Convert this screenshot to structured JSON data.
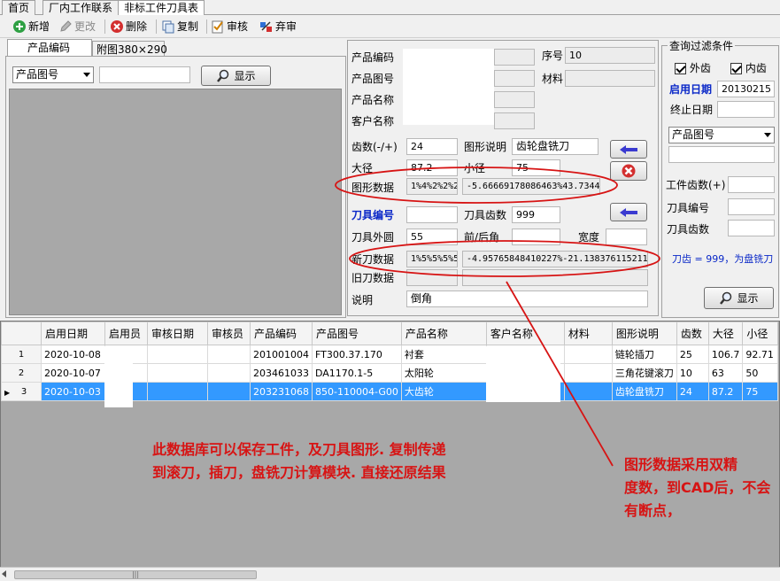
{
  "tabs": [
    {
      "label": "首页"
    },
    {
      "label": "厂内工作联系"
    },
    {
      "label": "非标工件刀具表"
    }
  ],
  "toolbar": {
    "new": "新增",
    "edit": "更改",
    "delete": "删除",
    "copy": "复制",
    "approve": "审核",
    "unapprove": "弃审"
  },
  "left_tabs": {
    "code": "产品编码",
    "image": "附图380×290"
  },
  "left": {
    "dropdown": "产品图号",
    "search_value": "",
    "show_button": "显示"
  },
  "form": {
    "product_code_label": "产品编码",
    "product_code": "",
    "seq_label": "序号",
    "seq": "10",
    "drawing_no_label": "产品图号",
    "drawing_no": "",
    "material_label": "材料",
    "material": "",
    "product_name_label": "产品名称",
    "product_name": "",
    "customer_label": "客户名称",
    "customer": "",
    "teeth_label": "齿数(-/+)",
    "teeth": "24",
    "shape_desc_label": "图形说明",
    "shape_desc": "齿轮盘铣刀",
    "major_label": "大径",
    "major": "87.2",
    "minor_label": "小径",
    "minor": "75",
    "shape_data_label": "图形数据",
    "shape_data_a": "1%4%2%2%2",
    "shape_data_b": "-5.66669178086463%43.7344",
    "tool_no_label": "刀具编号",
    "tool_no": "",
    "tool_teeth_label": "刀具齿数",
    "tool_teeth": "999",
    "tool_od_label": "刀具外圆",
    "tool_od": "55",
    "front_back_label": "前/后角",
    "front_back": "",
    "width_label": "宽度",
    "width": "",
    "new_tool_label": "新刀数据",
    "new_tool_a": "1%5%5%5%5",
    "new_tool_b": "-4.95765848410227%-21.138376115211",
    "old_tool_label": "旧刀数据",
    "old_tool": "",
    "remark_label": "说明",
    "remark": "倒角"
  },
  "filter": {
    "title": "查询过滤条件",
    "out_label": "外齿",
    "in_label": "内齿",
    "start_label": "启用日期",
    "start_value": "20130215",
    "end_label": "终止日期",
    "end_value": "",
    "dropdown": "产品图号",
    "search_value": "",
    "teeth_label": "工件齿数(+)",
    "tool_no_label": "刀具编号",
    "tool_teeth_label": "刀具齿数",
    "note": "刀齿 = 999，为盘铣刀",
    "show_button": "显示"
  },
  "grid": {
    "columns": [
      "启用日期",
      "启用员",
      "审核日期",
      "审核员",
      "产品编码",
      "产品图号",
      "产品名称",
      "客户名称",
      "材料",
      "图形说明",
      "齿数",
      "大径",
      "小径"
    ],
    "rows": [
      {
        "no": "1",
        "cells": [
          "2020-10-08",
          "",
          "",
          "",
          "201001004",
          "FT300.37.170",
          "衬套",
          "",
          "",
          "链轮插刀",
          "25",
          "106.7",
          "92.71"
        ]
      },
      {
        "no": "2",
        "cells": [
          "2020-10-07",
          "",
          "",
          "",
          "203461033",
          "DA1170.1-5",
          "太阳轮",
          "",
          "",
          "三角花键滚刀",
          "10",
          "63",
          "50"
        ]
      },
      {
        "no": "3",
        "cells": [
          "2020-10-03",
          "",
          "",
          "",
          "203231068",
          "850-110004-G00",
          "大齿轮",
          "",
          "",
          "齿轮盘铣刀",
          "24",
          "87.2",
          "75"
        ]
      }
    ]
  },
  "annotations": {
    "left": [
      "此数据库可以保存工件，及刀具图形. 复制传递",
      "到滚刀，插刀，盘铣刀计算模块. 直接还原结果"
    ],
    "right": [
      "图形数据采用双精",
      "度数，到CAD后，不会",
      "有断点，"
    ]
  },
  "scroll_glyph": "|||",
  "colors": {
    "annotation": "#d71414",
    "selection": "#3399ff",
    "label_blue": "#0a28c8"
  }
}
